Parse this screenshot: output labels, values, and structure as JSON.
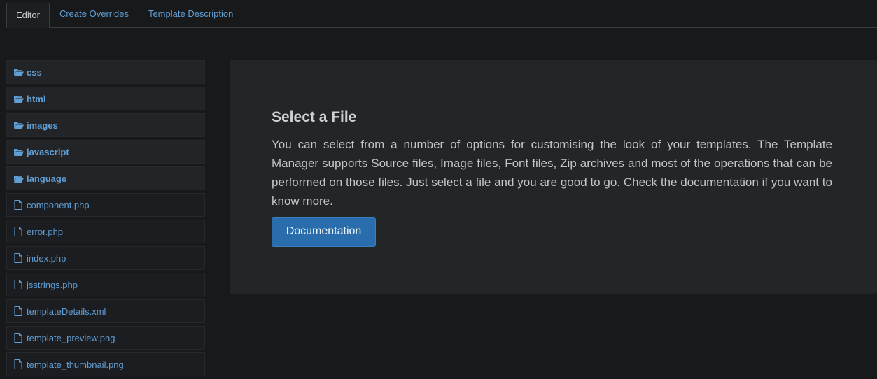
{
  "tabs": [
    {
      "label": "Editor",
      "active": true
    },
    {
      "label": "Create Overrides",
      "active": false
    },
    {
      "label": "Template Description",
      "active": false
    }
  ],
  "tree": {
    "folders": [
      {
        "label": "css",
        "icon": "folder-open-icon"
      },
      {
        "label": "html",
        "icon": "folder-open-icon"
      },
      {
        "label": "images",
        "icon": "folder-open-icon"
      },
      {
        "label": "javascript",
        "icon": "folder-open-icon"
      },
      {
        "label": "language",
        "icon": "folder-open-icon"
      }
    ],
    "files": [
      {
        "label": "component.php",
        "icon": "file-icon"
      },
      {
        "label": "error.php",
        "icon": "file-icon"
      },
      {
        "label": "index.php",
        "icon": "file-icon"
      },
      {
        "label": "jsstrings.php",
        "icon": "file-icon"
      },
      {
        "label": "templateDetails.xml",
        "icon": "file-icon"
      },
      {
        "label": "template_preview.png",
        "icon": "file-icon"
      },
      {
        "label": "template_thumbnail.png",
        "icon": "file-icon"
      }
    ]
  },
  "panel": {
    "title": "Select a File",
    "body": "You can select from a number of options for customising the look of your templates. The Template Manager supports Source files, Image files, Font files, Zip archives and most of the operations that can be performed on those files. Just select a file and you are good to go. Check the documentation if you want to know more.",
    "button_label": "Documentation"
  },
  "colors": {
    "link": "#5f9fd6",
    "button": "#2a6dad",
    "background": "#18191b",
    "panel": "#242527"
  }
}
